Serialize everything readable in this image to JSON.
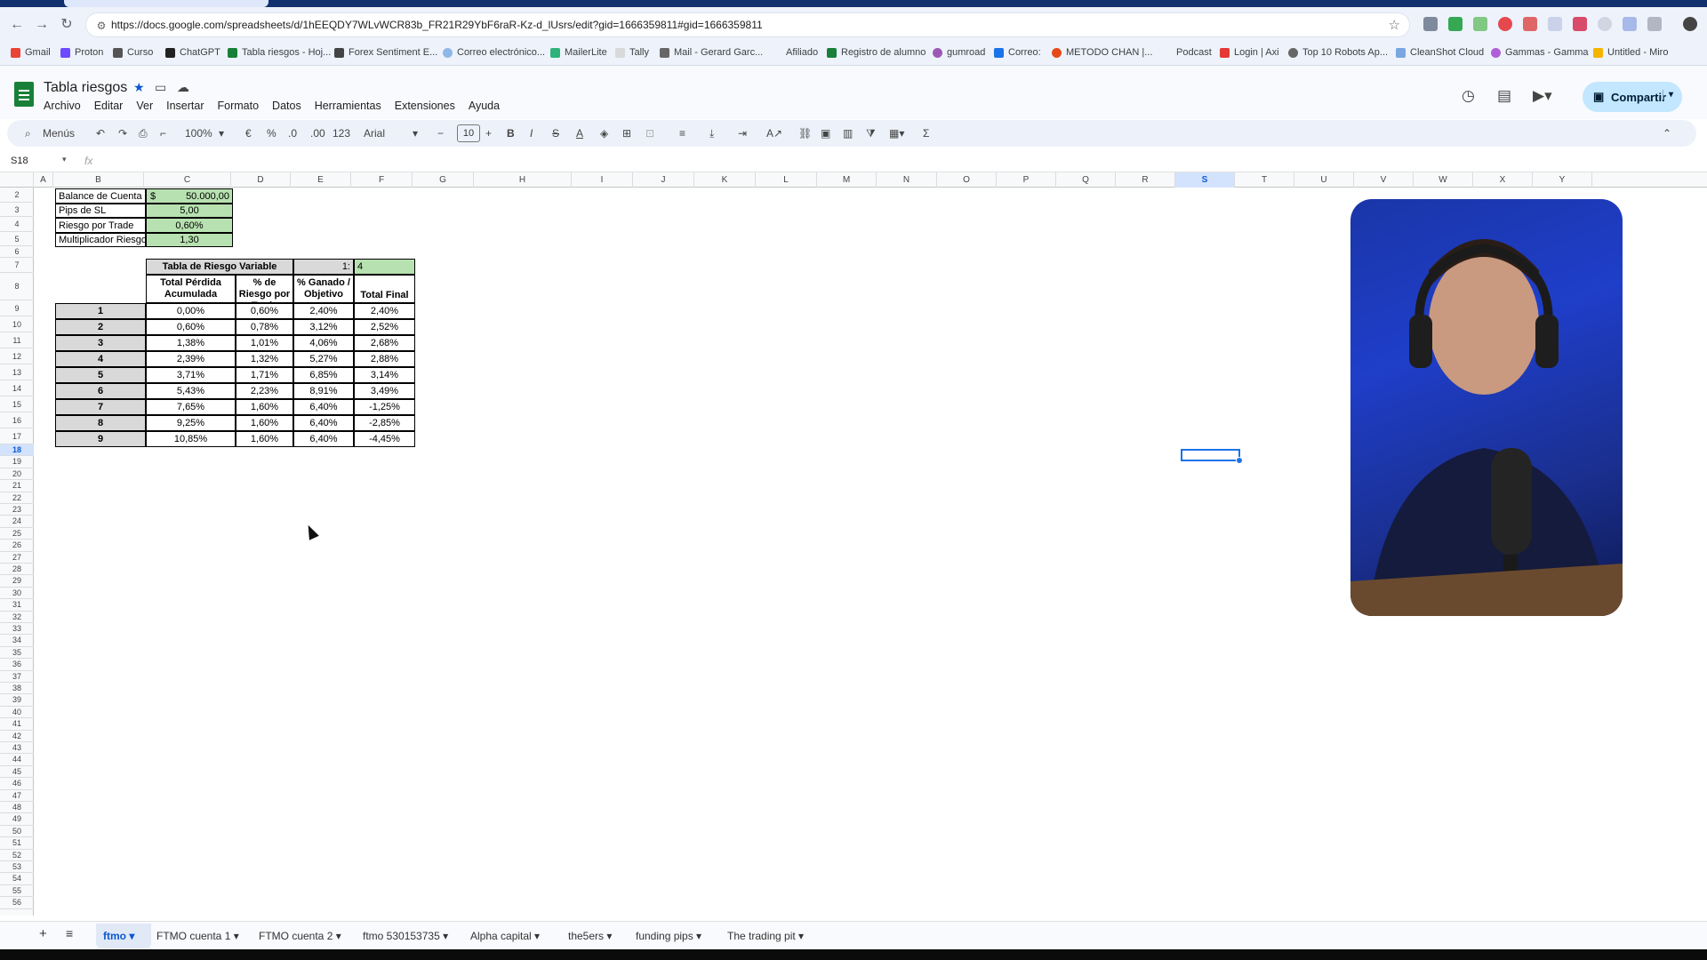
{
  "browser": {
    "url": "https://docs.google.com/spreadsheets/d/1hEEQDY7WLvWCR83b_FR21R29YbF6raR-Kz-d_lUsrs/edit?gid=1666359811#gid=1666359811",
    "bookmarks": [
      "Gmail",
      "Proton",
      "Curso",
      "ChatGPT",
      "Tabla riesgos - Hoj...",
      "Forex Sentiment E...",
      "Correo electrónico...",
      "MailerLite",
      "Tally",
      "Mail - Gerard Garc...",
      "Afiliado",
      "Registro de alumno",
      "gumroad",
      "Correo:",
      "METODO CHAN |...",
      "Podcast",
      "Login | Axi",
      "Top 10 Robots Ap...",
      "CleanShot Cloud",
      "Gammas - Gamma",
      "Untitled - Miro"
    ]
  },
  "app": {
    "title": "Tabla riesgos",
    "menus": [
      "Archivo",
      "Editar",
      "Ver",
      "Insertar",
      "Formato",
      "Datos",
      "Herramientas",
      "Extensiones",
      "Ayuda"
    ],
    "share_label": "Compartir"
  },
  "toolbar": {
    "search": "Menús",
    "zoom": "100%",
    "currency": "€",
    "percent": "%",
    "dec_minus": ".0",
    "dec_plus": ".00",
    "format_123": "123",
    "font": "Arial",
    "font_size": "10"
  },
  "formula": {
    "name_box": "S18",
    "fx": "fx"
  },
  "columns": [
    "A",
    "B",
    "C",
    "D",
    "E",
    "F",
    "G",
    "H",
    "I",
    "J",
    "K",
    "L",
    "M",
    "N",
    "O",
    "P",
    "Q",
    "R",
    "S",
    "T",
    "U",
    "V",
    "W",
    "X",
    "Y"
  ],
  "selected_column": "S",
  "rows": [
    "2",
    "3",
    "4",
    "5",
    "6",
    "7",
    "8",
    "9",
    "10",
    "11",
    "12",
    "13",
    "14",
    "15",
    "16",
    "17",
    "18",
    "19",
    "20",
    "21",
    "22",
    "23",
    "24",
    "25",
    "26",
    "27",
    "28",
    "29",
    "30",
    "31",
    "32",
    "33",
    "34",
    "35",
    "36",
    "37",
    "38",
    "39",
    "40",
    "41",
    "42",
    "43",
    "44",
    "45",
    "46",
    "47",
    "48",
    "49",
    "50",
    "51",
    "52",
    "53",
    "54",
    "55",
    "56"
  ],
  "selected_row": "18",
  "params": [
    {
      "label": "Balance de Cuenta",
      "currency": "$",
      "value": "50.000,00"
    },
    {
      "label": "Pips de SL",
      "value": "5,00"
    },
    {
      "label": "Riesgo por Trade",
      "value": "0,60%"
    },
    {
      "label": "Multiplicador Riesgo",
      "value": "1,30"
    }
  ],
  "risk_table": {
    "title": "Tabla de Riesgo Variable",
    "ratio_label": "1:",
    "ratio_value": "4",
    "headers": [
      "Total Pérdida Acumulada",
      "% de Riesgo por Trade",
      "% Ganado / Objetivo",
      "Total Final"
    ],
    "rows": [
      {
        "n": "1",
        "loss": "0,00%",
        "risk": "0,60%",
        "gain": "2,40%",
        "final": "2,40%"
      },
      {
        "n": "2",
        "loss": "0,60%",
        "risk": "0,78%",
        "gain": "3,12%",
        "final": "2,52%"
      },
      {
        "n": "3",
        "loss": "1,38%",
        "risk": "1,01%",
        "gain": "4,06%",
        "final": "2,68%"
      },
      {
        "n": "4",
        "loss": "2,39%",
        "risk": "1,32%",
        "gain": "5,27%",
        "final": "2,88%"
      },
      {
        "n": "5",
        "loss": "3,71%",
        "risk": "1,71%",
        "gain": "6,85%",
        "final": "3,14%"
      },
      {
        "n": "6",
        "loss": "5,43%",
        "risk": "2,23%",
        "gain": "8,91%",
        "final": "3,49%"
      },
      {
        "n": "7",
        "loss": "7,65%",
        "risk": "1,60%",
        "gain": "6,40%",
        "final": "-1,25%"
      },
      {
        "n": "8",
        "loss": "9,25%",
        "risk": "1,60%",
        "gain": "6,40%",
        "final": "-2,85%"
      },
      {
        "n": "9",
        "loss": "10,85%",
        "risk": "1,60%",
        "gain": "6,40%",
        "final": "-4,45%"
      }
    ]
  },
  "sheets": [
    "ftmo",
    "FTMO cuenta 1",
    "FTMO cuenta 2",
    "ftmo 530153735",
    "Alpha capital",
    "the5ers",
    "funding pips",
    "The trading pit"
  ],
  "active_sheet": "ftmo",
  "colors": {
    "accent": "#0b57d0",
    "green_fill": "#b7e1b0",
    "header_gray": "#d9d9d9"
  }
}
